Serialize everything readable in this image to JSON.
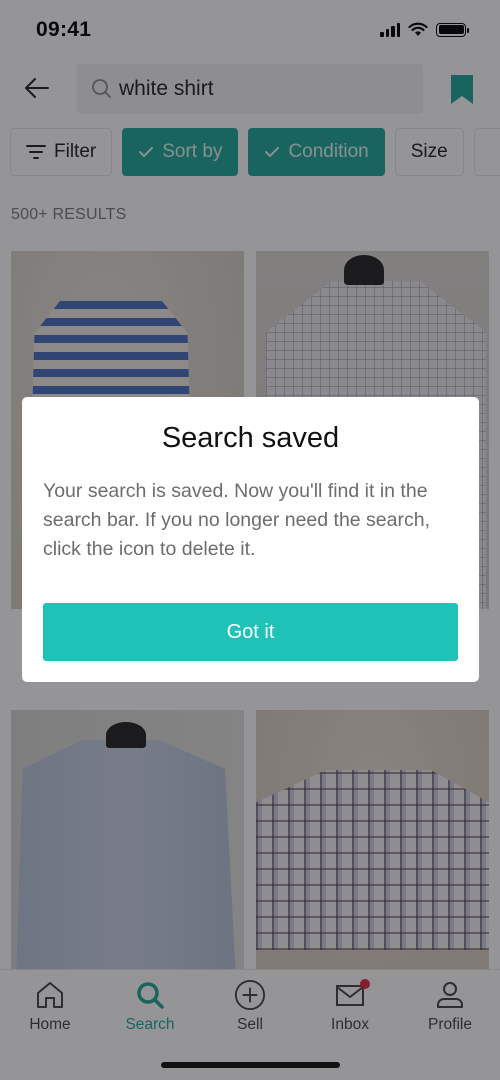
{
  "status_bar": {
    "time": "09:41",
    "icons": [
      "cellular-signal-icon",
      "wifi-icon",
      "battery-icon"
    ]
  },
  "header": {
    "back_icon": "arrow-left-icon",
    "search_icon": "search-icon",
    "search_value": "white shirt",
    "bookmark_icon": "bookmark-filled-icon",
    "bookmark_saved": true
  },
  "filters": {
    "chips": [
      {
        "label": "Filter",
        "icon": "filter-lines-icon",
        "active": false
      },
      {
        "label": "Sort by",
        "icon": "check-icon",
        "active": true
      },
      {
        "label": "Condition",
        "icon": "check-icon",
        "active": true
      },
      {
        "label": "Size",
        "icon": "",
        "active": false
      }
    ]
  },
  "results": {
    "count_label": "500+ RESULTS",
    "items": [
      {
        "description": "Blue and white striped shirt folded in plastic"
      },
      {
        "description": "White checked shirt on hanger"
      },
      {
        "description": "Light blue shirt on hanger"
      },
      {
        "description": "Checked shirt folded on carpet"
      }
    ]
  },
  "modal": {
    "title": "Search saved",
    "body": "Your search is saved. Now you'll find it in the search bar. If you no longer need the search, click the icon to delete it.",
    "button_label": "Got it"
  },
  "bottom_nav": {
    "items": [
      {
        "label": "Home",
        "icon": "home-icon",
        "active": false
      },
      {
        "label": "Search",
        "icon": "search-icon",
        "active": true
      },
      {
        "label": "Sell",
        "icon": "plus-circle-icon",
        "active": false
      },
      {
        "label": "Inbox",
        "icon": "mail-icon",
        "active": false,
        "has_notification": true
      },
      {
        "label": "Profile",
        "icon": "person-icon",
        "active": false
      }
    ]
  },
  "colors": {
    "accent": "#1fa89d",
    "button": "#1ec2b7",
    "notification": "#e0283c"
  }
}
